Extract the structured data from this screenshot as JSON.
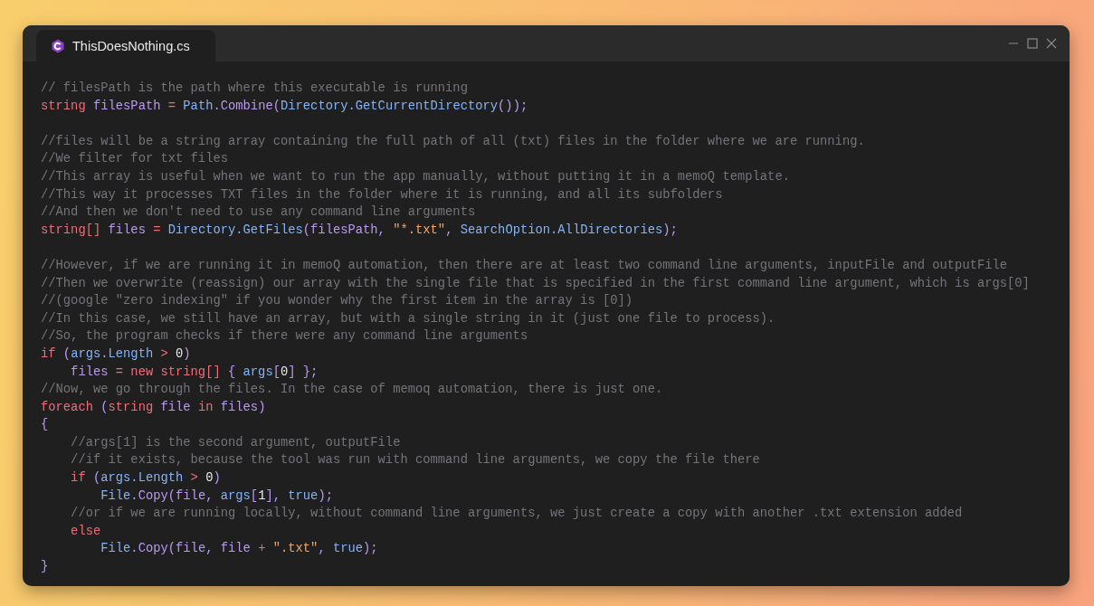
{
  "window": {
    "tabs": [
      {
        "label": "ThisDoesNothing.cs",
        "selected": true
      }
    ]
  },
  "code": {
    "lines": [
      {
        "kind": "code",
        "tokens": [
          {
            "kind": "c",
            "text": "// filesPath is the path where this executable is running"
          }
        ]
      },
      {
        "kind": "code",
        "tokens": [
          {
            "kind": "k",
            "text": "string"
          },
          {
            "kind": "v",
            "text": " filesPath"
          },
          {
            "kind": "o",
            "text": " = "
          },
          {
            "kind": "t",
            "text": "Path"
          },
          {
            "kind": "p",
            "text": "."
          },
          {
            "kind": "v",
            "text": "Combine"
          },
          {
            "kind": "p",
            "text": "("
          },
          {
            "kind": "t",
            "text": "Directory.GetCurrentDirectory"
          },
          {
            "kind": "p",
            "text": "());"
          }
        ]
      },
      {
        "kind": "blank"
      },
      {
        "kind": "code",
        "tokens": [
          {
            "kind": "c",
            "text": "//files will be a string array containing the full path of all (txt) files in the folder where we are running."
          }
        ]
      },
      {
        "kind": "code",
        "tokens": [
          {
            "kind": "c",
            "text": "//We filter for txt files"
          }
        ]
      },
      {
        "kind": "code",
        "tokens": [
          {
            "kind": "c",
            "text": "//This array is useful when we want to run the app manually, without putting it in a memoQ template."
          }
        ]
      },
      {
        "kind": "code",
        "tokens": [
          {
            "kind": "c",
            "text": "//This way it processes TXT files in the folder where it is running, and all its subfolders"
          }
        ]
      },
      {
        "kind": "code",
        "tokens": [
          {
            "kind": "c",
            "text": "//And then we don't need to use any command line arguments"
          }
        ]
      },
      {
        "kind": "code",
        "tokens": [
          {
            "kind": "k",
            "text": "string[]"
          },
          {
            "kind": "v",
            "text": " files"
          },
          {
            "kind": "o",
            "text": " = "
          },
          {
            "kind": "t",
            "text": "Directory.GetFiles"
          },
          {
            "kind": "p",
            "text": "("
          },
          {
            "kind": "v",
            "text": "filesPath"
          },
          {
            "kind": "p",
            "text": ", "
          },
          {
            "kind": "s",
            "text": "\"*.txt\""
          },
          {
            "kind": "p",
            "text": ", "
          },
          {
            "kind": "t",
            "text": "SearchOption.AllDirectories"
          },
          {
            "kind": "p",
            "text": ");"
          }
        ]
      },
      {
        "kind": "blank"
      },
      {
        "kind": "code",
        "tokens": [
          {
            "kind": "c",
            "text": "//However, if we are running it in memoQ automation, then there are at least two command line arguments, inputFile and outputFile"
          }
        ]
      },
      {
        "kind": "code",
        "tokens": [
          {
            "kind": "c",
            "text": "//Then we overwrite (reassign) our array with the single file that is specified in the first command line argument, which is args[0]"
          }
        ]
      },
      {
        "kind": "code",
        "tokens": [
          {
            "kind": "c",
            "text": "//(google \"zero indexing\" if you wonder why the first item in the array is [0])"
          }
        ]
      },
      {
        "kind": "code",
        "tokens": [
          {
            "kind": "c",
            "text": "//In this case, we still have an array, but with a single string in it (just one file to process)."
          }
        ]
      },
      {
        "kind": "code",
        "tokens": [
          {
            "kind": "c",
            "text": "//So, the program checks if there were any command line arguments"
          }
        ]
      },
      {
        "kind": "code",
        "tokens": [
          {
            "kind": "k",
            "text": "if"
          },
          {
            "kind": "p",
            "text": " ("
          },
          {
            "kind": "t",
            "text": "args.Length"
          },
          {
            "kind": "o",
            "text": " > "
          },
          {
            "kind": "n",
            "text": "0"
          },
          {
            "kind": "p",
            "text": ")"
          }
        ]
      },
      {
        "kind": "code",
        "tokens": [
          {
            "kind": "v",
            "text": "    files"
          },
          {
            "kind": "o",
            "text": " = "
          },
          {
            "kind": "k",
            "text": "new string[]"
          },
          {
            "kind": "p",
            "text": " { "
          },
          {
            "kind": "t",
            "text": "args"
          },
          {
            "kind": "p",
            "text": "["
          },
          {
            "kind": "n",
            "text": "0"
          },
          {
            "kind": "p",
            "text": "] };"
          }
        ]
      },
      {
        "kind": "code",
        "tokens": [
          {
            "kind": "c",
            "text": "//Now, we go through the files. In the case of memoq automation, there is just one."
          }
        ]
      },
      {
        "kind": "code",
        "tokens": [
          {
            "kind": "k",
            "text": "foreach"
          },
          {
            "kind": "p",
            "text": " ("
          },
          {
            "kind": "k",
            "text": "string"
          },
          {
            "kind": "v",
            "text": " file"
          },
          {
            "kind": "k",
            "text": " in"
          },
          {
            "kind": "v",
            "text": " files"
          },
          {
            "kind": "p",
            "text": ")"
          }
        ]
      },
      {
        "kind": "code",
        "tokens": [
          {
            "kind": "p",
            "text": "{"
          }
        ]
      },
      {
        "kind": "code",
        "tokens": [
          {
            "kind": "c",
            "text": "    //args[1] is the second argument, outputFile"
          }
        ]
      },
      {
        "kind": "code",
        "tokens": [
          {
            "kind": "c",
            "text": "    //if it exists, because the tool was run with command line arguments, we copy the file there"
          }
        ]
      },
      {
        "kind": "code",
        "tokens": [
          {
            "kind": "k",
            "text": "    if"
          },
          {
            "kind": "p",
            "text": " ("
          },
          {
            "kind": "t",
            "text": "args.Length"
          },
          {
            "kind": "o",
            "text": " > "
          },
          {
            "kind": "n",
            "text": "0"
          },
          {
            "kind": "p",
            "text": ")"
          }
        ]
      },
      {
        "kind": "code",
        "tokens": [
          {
            "kind": "t",
            "text": "        File"
          },
          {
            "kind": "p",
            "text": "."
          },
          {
            "kind": "v",
            "text": "Copy"
          },
          {
            "kind": "p",
            "text": "("
          },
          {
            "kind": "v",
            "text": "file"
          },
          {
            "kind": "p",
            "text": ", "
          },
          {
            "kind": "t",
            "text": "args"
          },
          {
            "kind": "p",
            "text": "["
          },
          {
            "kind": "n",
            "text": "1"
          },
          {
            "kind": "p",
            "text": "], "
          },
          {
            "kind": "t",
            "text": "true"
          },
          {
            "kind": "p",
            "text": ");"
          }
        ]
      },
      {
        "kind": "code",
        "tokens": [
          {
            "kind": "c",
            "text": "    //or if we are running locally, without command line arguments, we just create a copy with another .txt extension added"
          }
        ]
      },
      {
        "kind": "code",
        "tokens": [
          {
            "kind": "k",
            "text": "    else"
          }
        ]
      },
      {
        "kind": "code",
        "tokens": [
          {
            "kind": "t",
            "text": "        File"
          },
          {
            "kind": "p",
            "text": "."
          },
          {
            "kind": "v",
            "text": "Copy"
          },
          {
            "kind": "p",
            "text": "("
          },
          {
            "kind": "v",
            "text": "file"
          },
          {
            "kind": "p",
            "text": ", "
          },
          {
            "kind": "v",
            "text": "file"
          },
          {
            "kind": "o",
            "text": " + "
          },
          {
            "kind": "s",
            "text": "\".txt\""
          },
          {
            "kind": "p",
            "text": ", "
          },
          {
            "kind": "t",
            "text": "true"
          },
          {
            "kind": "p",
            "text": ");"
          }
        ]
      },
      {
        "kind": "code",
        "tokens": [
          {
            "kind": "p",
            "text": "}"
          }
        ]
      }
    ]
  }
}
